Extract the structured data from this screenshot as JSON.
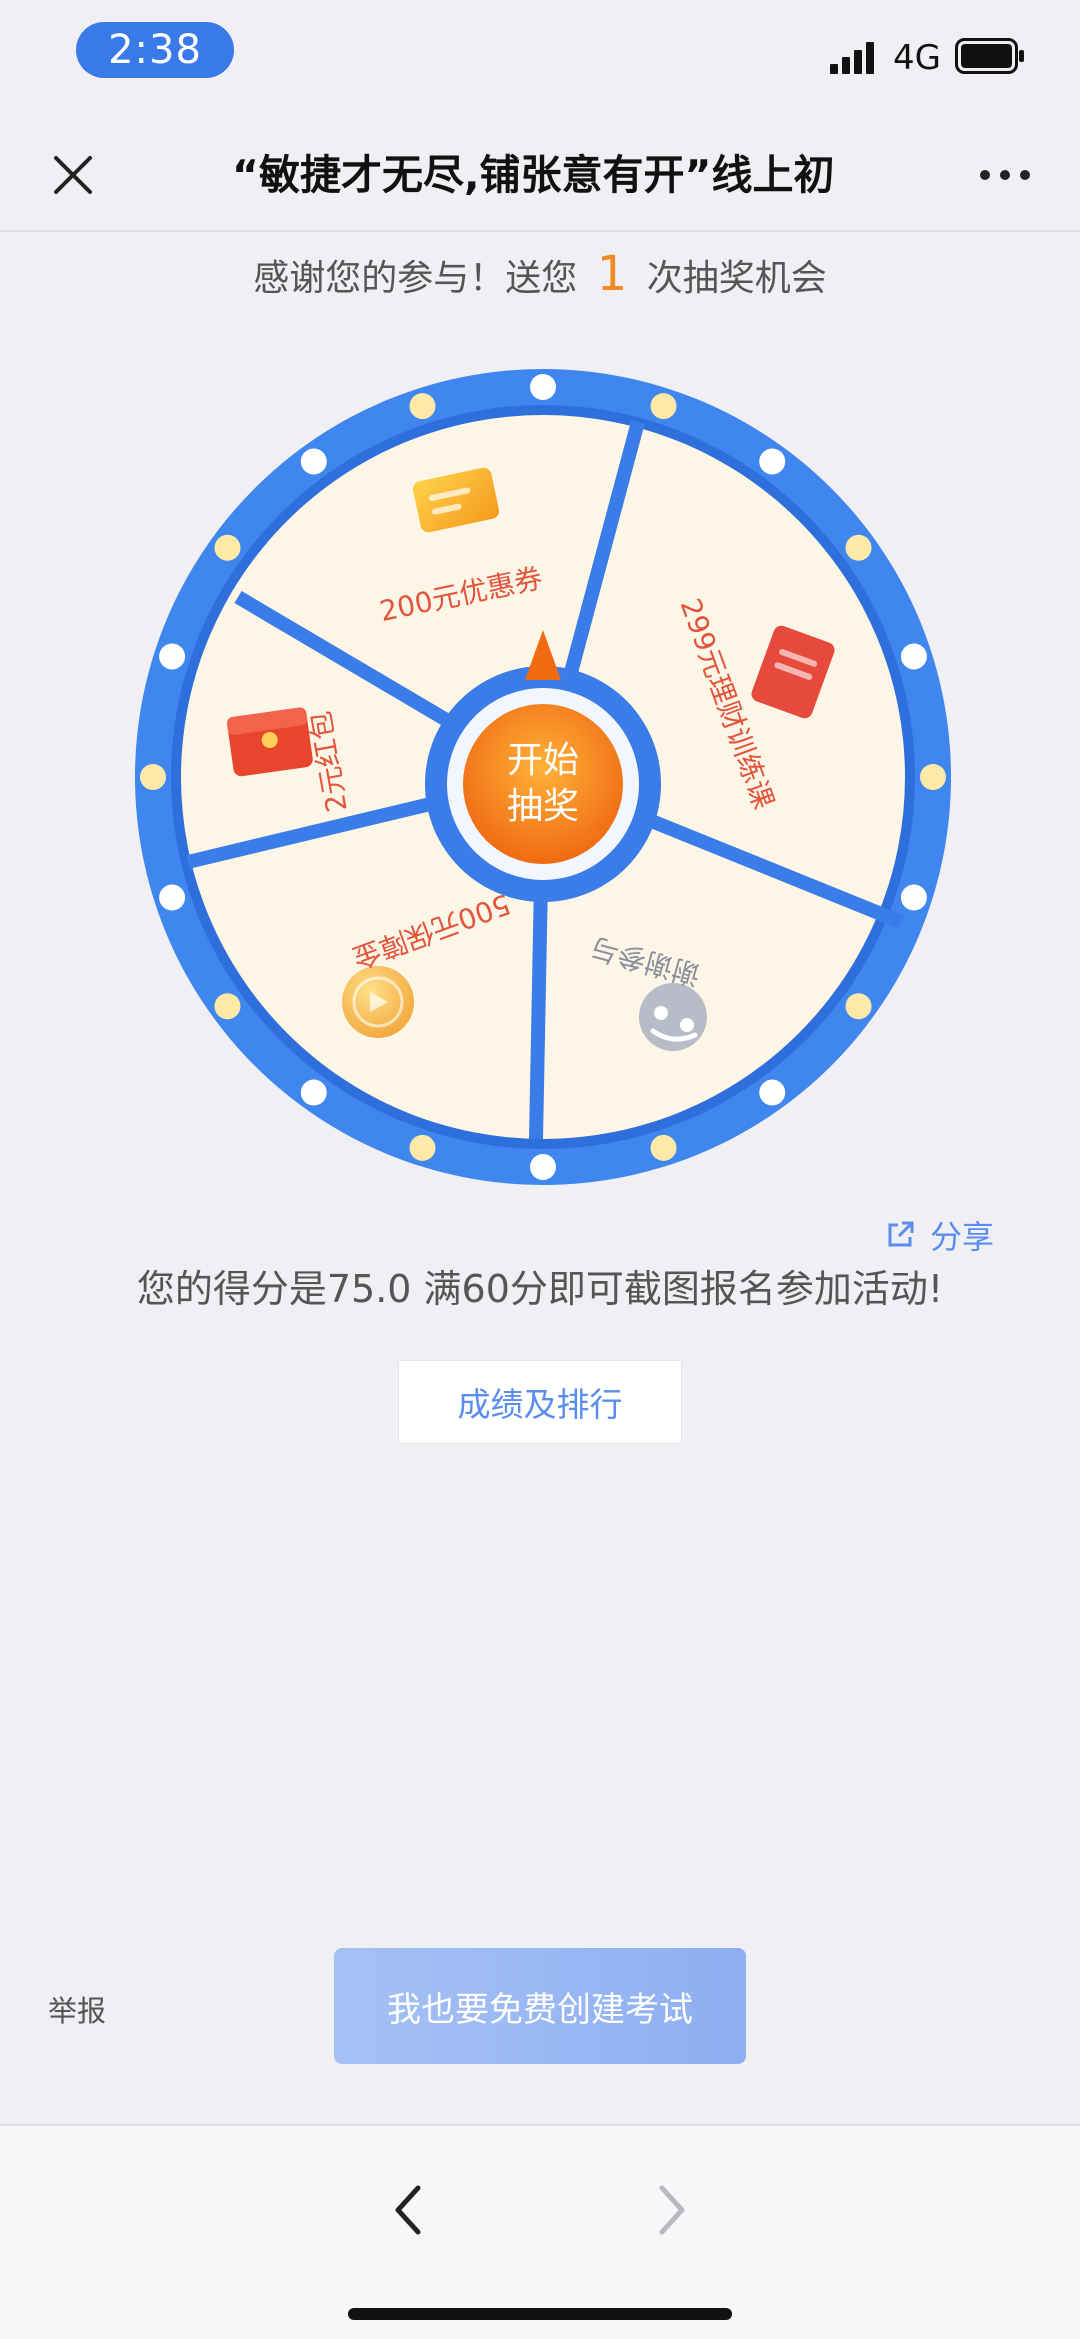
{
  "status_bar": {
    "time": "2:38",
    "network": "4G"
  },
  "nav": {
    "title": "“敏捷才无尽,铺张意有开”线上初"
  },
  "lottery": {
    "tip_prefix": "感谢您的参与！送您",
    "chance_count": "1",
    "tip_suffix": "次抽奖机会",
    "start_label_line1": "开始",
    "start_label_line2": "抽奖",
    "prizes": [
      "200元优惠券",
      "299元理财训练课",
      "谢谢参与",
      "500元保障金",
      "2元红包"
    ]
  },
  "share": {
    "label": "分享"
  },
  "score": {
    "text": "您的得分是75.0  满60分即可截图报名参加活动!"
  },
  "buttons": {
    "rank": "成绩及排行",
    "create": "我也要免费创建考试",
    "report": "举报"
  },
  "colors": {
    "accent_blue": "#3a7ce8",
    "orange": "#f08a24",
    "prize_text": "#e2553c",
    "wheel_cream": "#fdf6e6"
  },
  "icons": [
    "close-icon",
    "more-icon",
    "coupon-icon",
    "card-icon",
    "gift-icon",
    "coin-icon",
    "smiley-icon",
    "share-icon",
    "back-icon",
    "forward-icon"
  ]
}
